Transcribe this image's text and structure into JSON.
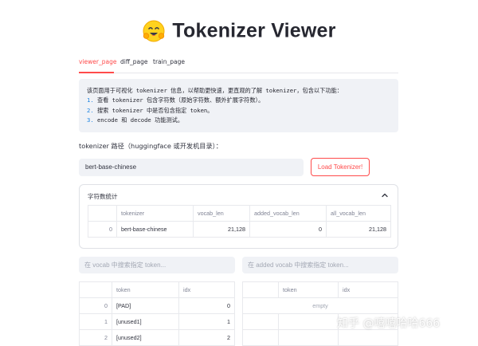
{
  "header": {
    "title": "Tokenizer Viewer"
  },
  "tabs": [
    {
      "label": "viewer_page"
    },
    {
      "label": "diff_page"
    },
    {
      "label": "train_page"
    }
  ],
  "info": {
    "intro": "该页面用于可视化 tokenizer 信息，以帮助更快速，更直观的了解 tokenizer，包含以下功能：",
    "items": [
      {
        "num": "1.",
        "text": "查看 tokenizer 包含字符数（原始字符数、额外扩展字符数）。"
      },
      {
        "num": "2.",
        "text": "搜索 tokenizer 中是否包含指定 token。"
      },
      {
        "num": "3.",
        "text": "encode 和 decode 功能测试。"
      }
    ]
  },
  "path_field": {
    "label": "tokenizer 路径（huggingface 或开发机目录）：",
    "value": "bert-base-chinese"
  },
  "load_button": {
    "label": "Load Tokenizer!"
  },
  "stats": {
    "header": "字符数统计",
    "columns": [
      "tokenizer",
      "vocab_len",
      "added_vocab_len",
      "all_vocab_len"
    ],
    "rows": [
      {
        "index": "0",
        "tokenizer": "bert-base-chinese",
        "vocab_len": "21,128",
        "added_vocab_len": "0",
        "all_vocab_len": "21,128"
      }
    ]
  },
  "search_vocab": {
    "placeholder": "在 vocab 中搜索指定 token..."
  },
  "search_added": {
    "placeholder": "在 added vocab 中搜索指定 token..."
  },
  "vocab_table": {
    "columns": [
      "token",
      "idx"
    ],
    "rows": [
      {
        "index": "0",
        "token": "[PAD]",
        "idx": "0"
      },
      {
        "index": "1",
        "token": "[unused1]",
        "idx": "1"
      },
      {
        "index": "2",
        "token": "[unused2]",
        "idx": "2"
      }
    ]
  },
  "added_table": {
    "columns": [
      "token",
      "idx"
    ],
    "empty_label": "empty"
  },
  "watermark": {
    "text": "知乎 @嘻嘻哈哈666"
  },
  "colors": {
    "accent": "#ff4b4b",
    "panel": "#f0f2f6",
    "border": "#dfe1e6"
  },
  "icons": {
    "title": "hugging-face-emoji",
    "expander": "chevron-up-icon"
  }
}
